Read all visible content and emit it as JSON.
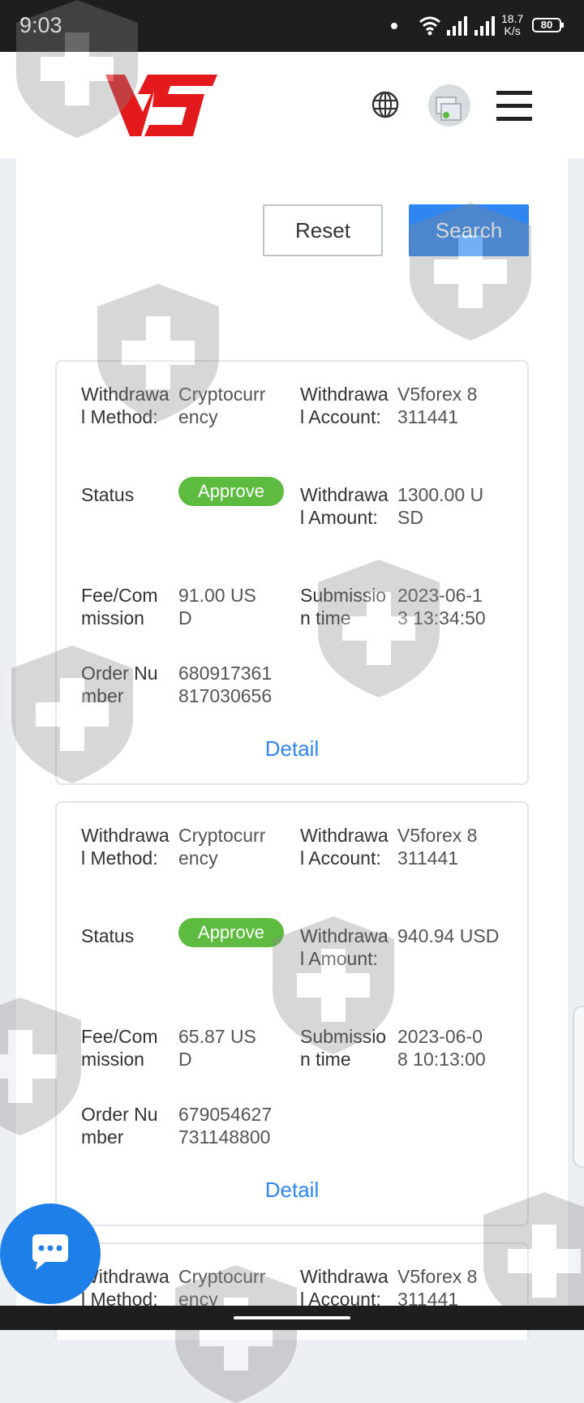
{
  "status_bar": {
    "time": "9:03",
    "speed_value": "18.7",
    "speed_unit": "K/s",
    "battery": "80"
  },
  "header": {
    "logo_text": "V5",
    "icons": [
      "globe-icon",
      "avatar",
      "hamburger-menu-icon"
    ]
  },
  "filters": {
    "reset_label": "Reset",
    "search_label": "Search"
  },
  "records": [
    {
      "method_label": "Withdrawal Method:",
      "method_value": "Cryptocurrency",
      "account_label": "Withdrawal Account:",
      "account_value": "V5forex 8311441",
      "status_label": "Status",
      "status_value": "Approve",
      "amount_label": "Withdrawal Amount:",
      "amount_value": "1300.00 USD",
      "fee_label": "Fee/Commission",
      "fee_value": "91.00 USD",
      "time_label": "Submission time",
      "time_value": "2023-06-13 13:34:50",
      "order_label": "Order Number",
      "order_value": "680917361817030656",
      "detail_label": "Detail"
    },
    {
      "method_label": "Withdrawal Method:",
      "method_value": "Cryptocurrency",
      "account_label": "Withdrawal Account:",
      "account_value": "V5forex 8311441",
      "status_label": "Status",
      "status_value": "Approve",
      "amount_label": "Withdrawal Amount:",
      "amount_value": "940.94 USD",
      "fee_label": "Fee/Commission",
      "fee_value": "65.87 USD",
      "time_label": "Submission time",
      "time_value": "2023-06-08 10:13:00",
      "order_label": "Order Number",
      "order_value": "679054627731148800",
      "detail_label": "Detail"
    },
    {
      "method_label": "Withdrawal Method:",
      "method_value": "Cryptocurrency",
      "account_label": "Withdrawal Account:",
      "account_value": "V5forex 8311441"
    }
  ],
  "colors": {
    "brand_red": "#e3191b",
    "accent_blue": "#2f86f0",
    "approve_green": "#5dbb3f",
    "chat_blue": "#1e7fe8"
  }
}
